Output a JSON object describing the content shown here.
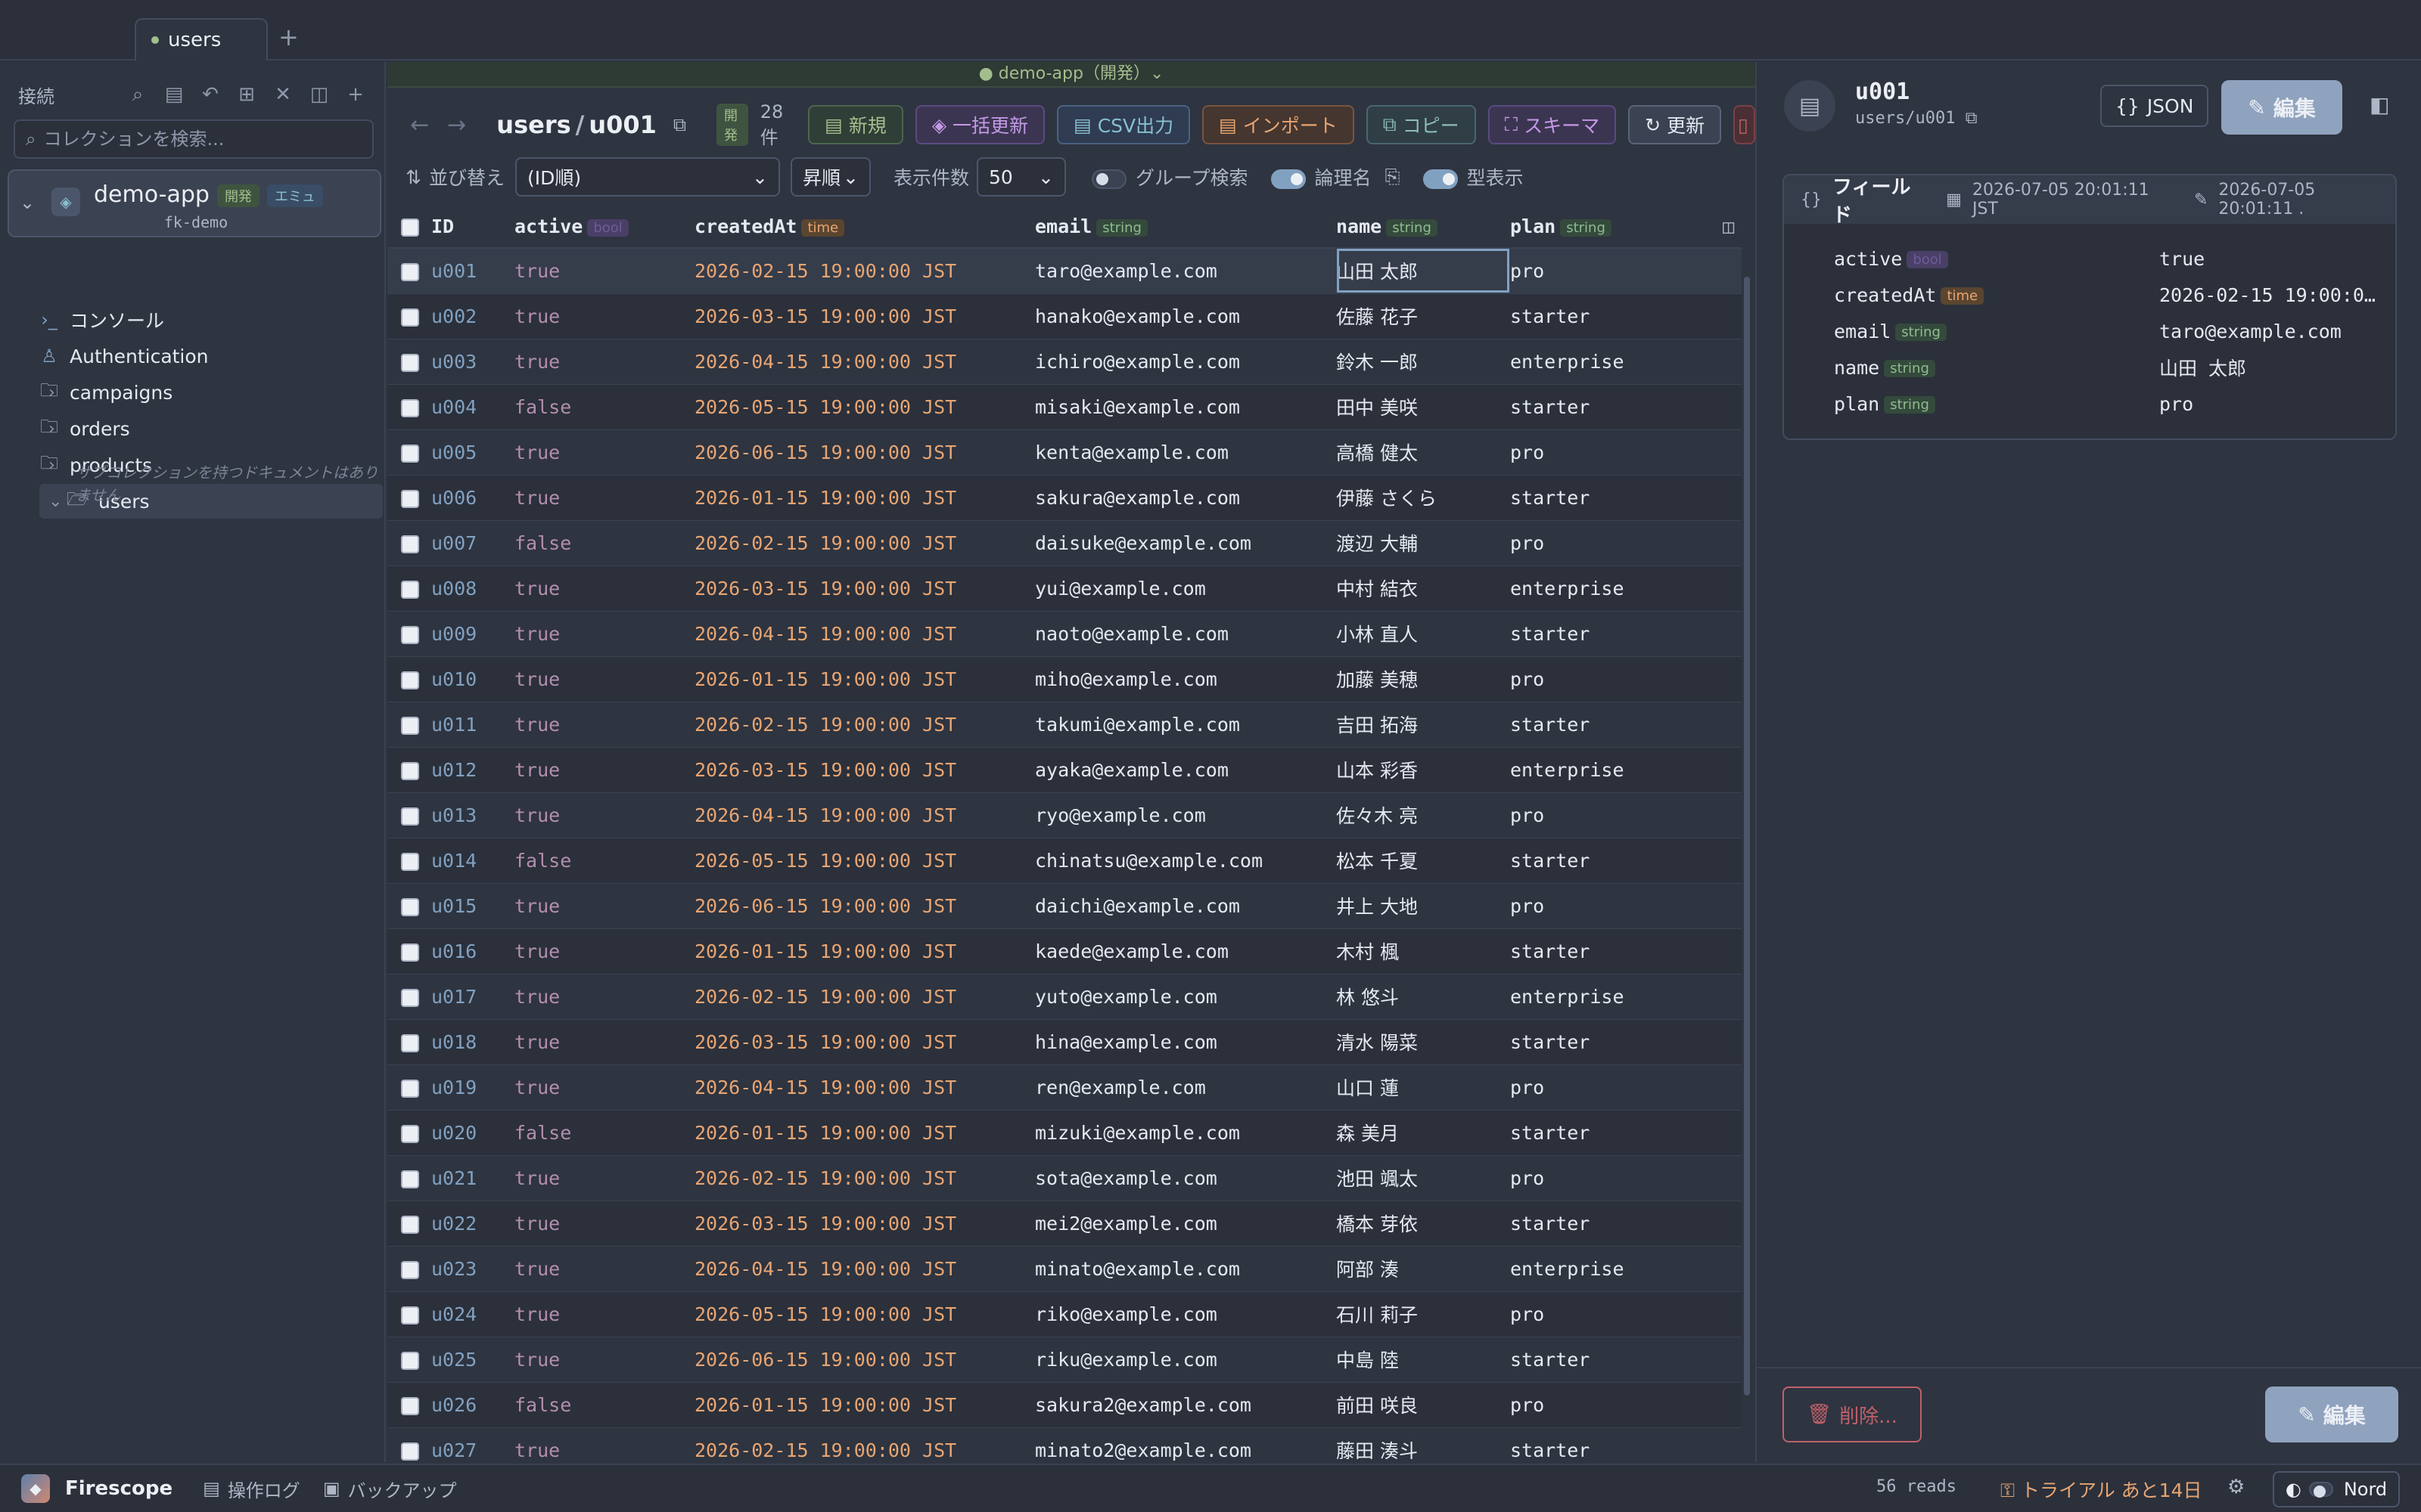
{
  "tabs": [
    {
      "label": "users"
    }
  ],
  "sidebar": {
    "title": "接続",
    "search_placeholder": "コレクションを検索...",
    "connection": {
      "name": "demo-app",
      "badge_env": "開発",
      "badge_emu": "エミュ",
      "project": "fk-demo"
    },
    "items": [
      {
        "label": "コンソール",
        "icon": "console-icon"
      },
      {
        "label": "Authentication",
        "icon": "users-icon"
      },
      {
        "label": "campaigns",
        "icon": "folder-icon"
      },
      {
        "label": "orders",
        "icon": "folder-icon"
      },
      {
        "label": "products",
        "icon": "folder-icon"
      },
      {
        "label": "users",
        "icon": "folder-open-icon"
      }
    ],
    "note": "サブコレクションを持つドキュメントはありません"
  },
  "main": {
    "connection_strip": "● demo-app（開発）⌄",
    "path_collection": "users",
    "path_sep": "/",
    "path_doc": "u001",
    "env_badge": "開発",
    "count": "28 件",
    "buttons": {
      "new": "新規",
      "bulk": "一括更新",
      "csv": "CSV出力",
      "import": "インポート",
      "copy": "コピー",
      "schema": "スキーマ",
      "refresh": "更新"
    },
    "filter": {
      "sort_label": "並び替え",
      "sort_value": "(ID順)",
      "order_value": "昇順",
      "pagesize_label": "表示件数",
      "pagesize_value": "50",
      "group_label": "グループ検索",
      "logical_label": "論理名",
      "types_label": "型表示"
    }
  },
  "table": {
    "columns": [
      {
        "label": "ID",
        "type": ""
      },
      {
        "label": "active",
        "type": "bool"
      },
      {
        "label": "createdAt",
        "type": "time"
      },
      {
        "label": "email",
        "type": "string"
      },
      {
        "label": "name",
        "type": "string"
      },
      {
        "label": "plan",
        "type": "string"
      }
    ],
    "rows": [
      [
        "u001",
        "true",
        "2026-02-15 19:00:00 JST",
        "taro@example.com",
        "山田 太郎",
        "pro"
      ],
      [
        "u002",
        "true",
        "2026-03-15 19:00:00 JST",
        "hanako@example.com",
        "佐藤 花子",
        "starter"
      ],
      [
        "u003",
        "true",
        "2026-04-15 19:00:00 JST",
        "ichiro@example.com",
        "鈴木 一郎",
        "enterprise"
      ],
      [
        "u004",
        "false",
        "2026-05-15 19:00:00 JST",
        "misaki@example.com",
        "田中 美咲",
        "starter"
      ],
      [
        "u005",
        "true",
        "2026-06-15 19:00:00 JST",
        "kenta@example.com",
        "高橋 健太",
        "pro"
      ],
      [
        "u006",
        "true",
        "2026-01-15 19:00:00 JST",
        "sakura@example.com",
        "伊藤 さくら",
        "starter"
      ],
      [
        "u007",
        "false",
        "2026-02-15 19:00:00 JST",
        "daisuke@example.com",
        "渡辺 大輔",
        "pro"
      ],
      [
        "u008",
        "true",
        "2026-03-15 19:00:00 JST",
        "yui@example.com",
        "中村 結衣",
        "enterprise"
      ],
      [
        "u009",
        "true",
        "2026-04-15 19:00:00 JST",
        "naoto@example.com",
        "小林 直人",
        "starter"
      ],
      [
        "u010",
        "true",
        "2026-01-15 19:00:00 JST",
        "miho@example.com",
        "加藤 美穂",
        "pro"
      ],
      [
        "u011",
        "true",
        "2026-02-15 19:00:00 JST",
        "takumi@example.com",
        "吉田 拓海",
        "starter"
      ],
      [
        "u012",
        "true",
        "2026-03-15 19:00:00 JST",
        "ayaka@example.com",
        "山本 彩香",
        "enterprise"
      ],
      [
        "u013",
        "true",
        "2026-04-15 19:00:00 JST",
        "ryo@example.com",
        "佐々木 亮",
        "pro"
      ],
      [
        "u014",
        "false",
        "2026-05-15 19:00:00 JST",
        "chinatsu@example.com",
        "松本 千夏",
        "starter"
      ],
      [
        "u015",
        "true",
        "2026-06-15 19:00:00 JST",
        "daichi@example.com",
        "井上 大地",
        "pro"
      ],
      [
        "u016",
        "true",
        "2026-01-15 19:00:00 JST",
        "kaede@example.com",
        "木村 楓",
        "starter"
      ],
      [
        "u017",
        "true",
        "2026-02-15 19:00:00 JST",
        "yuto@example.com",
        "林 悠斗",
        "enterprise"
      ],
      [
        "u018",
        "true",
        "2026-03-15 19:00:00 JST",
        "hina@example.com",
        "清水 陽菜",
        "starter"
      ],
      [
        "u019",
        "true",
        "2026-04-15 19:00:00 JST",
        "ren@example.com",
        "山口 蓮",
        "pro"
      ],
      [
        "u020",
        "false",
        "2026-01-15 19:00:00 JST",
        "mizuki@example.com",
        "森 美月",
        "starter"
      ],
      [
        "u021",
        "true",
        "2026-02-15 19:00:00 JST",
        "sota@example.com",
        "池田 颯太",
        "pro"
      ],
      [
        "u022",
        "true",
        "2026-03-15 19:00:00 JST",
        "mei2@example.com",
        "橋本 芽依",
        "starter"
      ],
      [
        "u023",
        "true",
        "2026-04-15 19:00:00 JST",
        "minato@example.com",
        "阿部 湊",
        "enterprise"
      ],
      [
        "u024",
        "true",
        "2026-05-15 19:00:00 JST",
        "riko@example.com",
        "石川 莉子",
        "pro"
      ],
      [
        "u025",
        "true",
        "2026-06-15 19:00:00 JST",
        "riku@example.com",
        "中島 陸",
        "starter"
      ],
      [
        "u026",
        "false",
        "2026-01-15 19:00:00 JST",
        "sakura2@example.com",
        "前田 咲良",
        "pro"
      ],
      [
        "u027",
        "true",
        "2026-02-15 19:00:00 JST",
        "minato2@example.com",
        "藤田 湊斗",
        "starter"
      ]
    ]
  },
  "detail": {
    "title": "u001",
    "path": "users/u001",
    "json_button": "JSON",
    "edit_button": "編集",
    "fields_title": "フィールド",
    "created_ts": "2026-07-05 20:01:11 JST",
    "updated_ts": "2026-07-05 20:01:11 .",
    "fields": [
      {
        "key": "active",
        "type": "bool",
        "value": "true"
      },
      {
        "key": "createdAt",
        "type": "time",
        "value": "2026-02-15 19:00:0…"
      },
      {
        "key": "email",
        "type": "string",
        "value": "taro@example.com"
      },
      {
        "key": "name",
        "type": "string",
        "value": "山田 太郎"
      },
      {
        "key": "plan",
        "type": "string",
        "value": "pro"
      }
    ],
    "delete_button": "削除...",
    "edit_button2": "編集"
  },
  "statusbar": {
    "app_name": "Firescope",
    "oplog": "操作ログ",
    "backup": "バックアップ",
    "reads": "56 reads",
    "trial": "トライアル あと14日",
    "theme": "Nord"
  },
  "colors": {
    "accent": "#81a1c1",
    "bool": "#b48ead",
    "time": "#e8a572",
    "id": "#81a1c1",
    "danger": "#bf616a"
  }
}
